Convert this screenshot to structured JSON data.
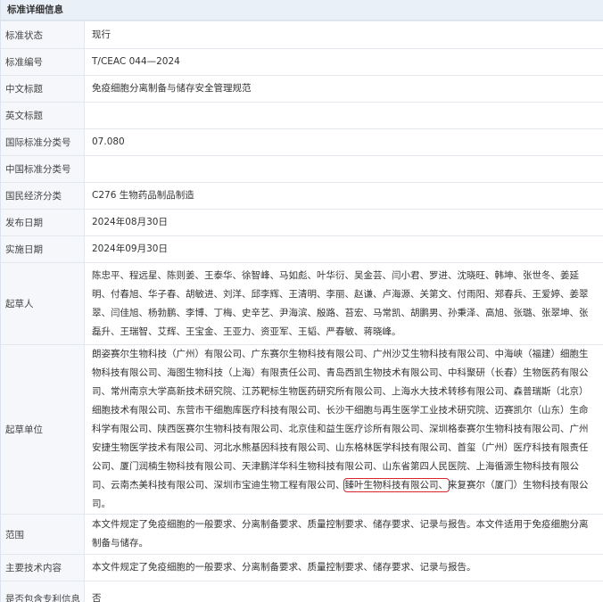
{
  "panel": {
    "title": "标准详细信息"
  },
  "rows": [
    {
      "label": "标准状态",
      "value": "现行"
    },
    {
      "label": "标准编号",
      "value": "T/CEAC 044—2024"
    },
    {
      "label": "中文标题",
      "value": "免疫细胞分离制备与储存安全管理规范"
    },
    {
      "label": "英文标题",
      "value": ""
    },
    {
      "label": "国际标准分类号",
      "value": "07.080"
    },
    {
      "label": "中国标准分类号",
      "value": ""
    },
    {
      "label": "国民经济分类",
      "value": "C276 生物药品制品制造"
    },
    {
      "label": "发布日期",
      "value": "2024年08月30日"
    },
    {
      "label": "实施日期",
      "value": "2024年09月30日"
    },
    {
      "label": "起草人",
      "value": "陈忠平、程远星、陈则姜、王泰华、徐智峰、马如彪、叶华衍、吴金芸、闫小君、罗进、沈晓旺、韩坤、张世冬、姜延明、付春旭、华子春、胡敏进、刘洋、邱李辉、王清明、李丽、赵谦、卢海源、关第文、付雨阳、郑春兵、王爱婷、姜翠翠、闫佳旭、杨勃鹏、李博、丁梅、史辛艺、尹海滨、殷路、苔宏、马常凯、胡鹏男、孙秉泽、高旭、张璐、张翠坤、张磊升、王瑞智、艾辉、王宝金、王亚力、资亚军、王韬、严春敏、蒋晓峰。"
    },
    {
      "label": "起草单位",
      "value_before": "朗姿赛尔生物科技（广州）有限公司、广东赛尔生物科技有限公司、广州沙艾生物科技有限公司、中海峡（福建）细胞生物科技有限公司、海图生物科技（上海）有限责任公司、青岛西凯生物技术有限公司、中科聚研（长春）生物医药有限公司、常州南京大学高新技术研究院、江苏靶标生物医药研究所有限公司、上海水大技术转移有限公司、森普瑞斯（北京）细胞技术有限公司、东营市干细胞库医疗科技有限公司、长沙干细胞与再生医学工业技术研究院、迈赛凯尔（山东）生命科学有限公司、陕西医赛尔生物科技有限公司、北京佳和益生医疗诊所有限公司、深圳格泰赛尔生物科技有限公司、广州安捷生物医学技术有限公司、河北水熊基因科技有限公司、山东格林医学科技有限公司、首玺（广州）医疗科技有限责任公司、厦门润楠生物科技有限公司、天津鹏洋华科生物科技有限公司、山东省第四人民医院、上海循源生物科技有限公司、云南杰美科技有限公司、深圳市宝迪生物工程有限公司、",
      "value_highlight": "臻叶生物科技有限公司、",
      "value_after": "来复赛尔（厦门）生物科技有限公司。"
    },
    {
      "label": "范围",
      "value": "本文件规定了免疫细胞的一般要求、分离制备要求、质量控制要求、储存要求、记录与报告。本文件适用于免疫细胞分离制备与储存。"
    },
    {
      "label": "主要技术内容",
      "value": "本文件规定了免疫细胞的一般要求、分离制备要求、质量控制要求、储存要求、记录与报告。"
    },
    {
      "label": "是否包含专利信息",
      "value": "否"
    }
  ]
}
